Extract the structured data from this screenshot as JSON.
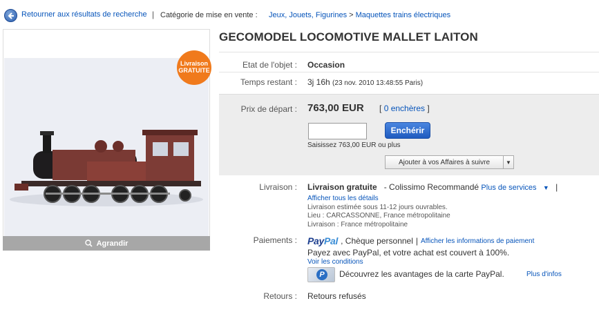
{
  "breadcrumb": {
    "back_label": "Retourner aux résultats de recherche",
    "separator": "|",
    "category_label": "Catégorie de mise en vente :",
    "crumbs": [
      "Jeux, Jouets, Figurines",
      "Maquettes trains électriques"
    ],
    "crumb_separator": ">"
  },
  "listing": {
    "title": "GECOMODEL LOCOMOTIVE MALLET LAITON",
    "badge_line1": "Livraison",
    "badge_line2": "GRATUITE",
    "enlarge_label": "Agrandir"
  },
  "details": {
    "state_label": "Etat de l'objet :",
    "state_value": "Occasion",
    "time_label": "Temps restant :",
    "time_value": "3j 16h",
    "time_detail": "(23 nov. 2010 13:48:55 Paris)",
    "start_price_label": "Prix de départ :",
    "start_price": "763,00 EUR",
    "bids_open": "[",
    "bids_link": "0 enchères",
    "bids_close": "]",
    "bid_input_value": "",
    "bid_button": "Enchérir",
    "bid_hint": "Saisissez 763,00 EUR ou plus",
    "watch_button": "Ajouter à vos Affaires à suivre"
  },
  "shipping": {
    "label": "Livraison :",
    "title": "Livraison gratuite",
    "method": "- Colissimo Recommandé",
    "more_services": "Plus de services",
    "see_all": "Afficher tous les détails",
    "estimate": "Livraison estimée sous 11-12 jours ouvrables.",
    "location": "Lieu : CARCASSONNE, France métropolitaine",
    "delivery": "Livraison : France métropolitaine"
  },
  "payment": {
    "label": "Paiements :",
    "paypal_part1": "Pay",
    "paypal_part2": "Pal",
    "check": ", Chèque personnel",
    "separator": "|",
    "info_link": "Afficher les informations de paiement",
    "coverage": "Payez avec PayPal, et votre achat est couvert à 100%.",
    "conditions_link": "Voir les conditions",
    "card_promo": "Découvrez les avantages de la carte PayPal.",
    "card_more": "Plus d'infos"
  },
  "returns": {
    "label": "Retours :",
    "value": "Retours refusés"
  },
  "colors": {
    "link": "#0654ba",
    "badge": "#f07a1c",
    "bid_button": "#1f5bbf",
    "bid_box": "#ededed"
  }
}
